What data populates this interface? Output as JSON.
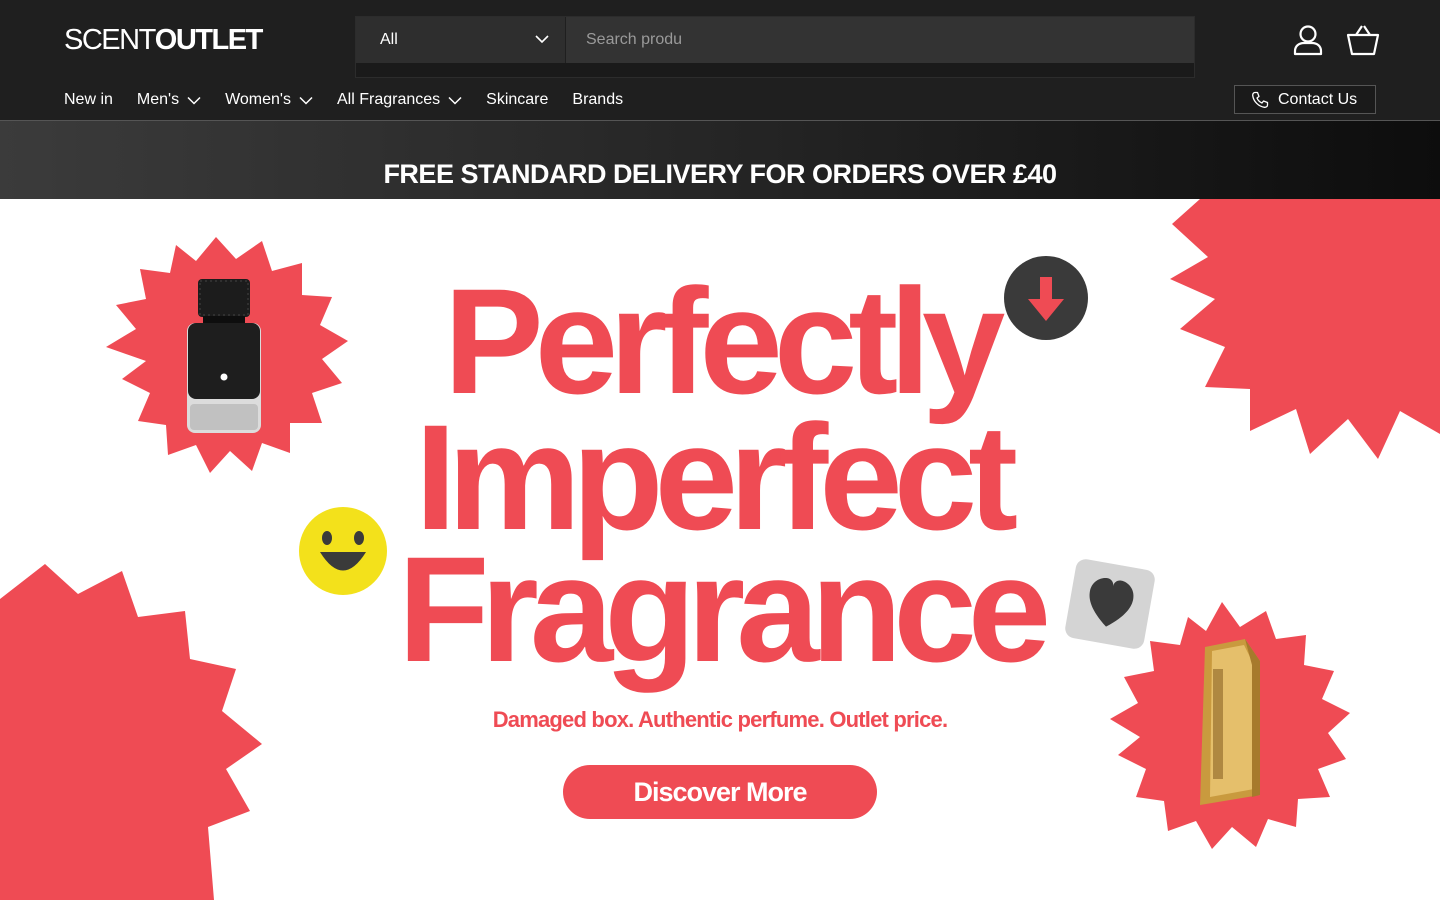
{
  "header": {
    "logo": {
      "part1": "SCENT",
      "part2": "OUTLET"
    },
    "search": {
      "category_selected": "All",
      "placeholder": "Search produ"
    },
    "nav": [
      {
        "label": "New in",
        "has_dropdown": false
      },
      {
        "label": "Men's",
        "has_dropdown": true
      },
      {
        "label": "Women's",
        "has_dropdown": true
      },
      {
        "label": "All Fragrances",
        "has_dropdown": true
      },
      {
        "label": "Skincare",
        "has_dropdown": false
      },
      {
        "label": "Brands",
        "has_dropdown": false
      }
    ],
    "contact_label": "Contact Us",
    "icons": [
      "account-icon",
      "basket-icon",
      "phone-icon",
      "chevron-down-icon"
    ]
  },
  "announcement": "FREE STANDARD DELIVERY FOR ORDERS OVER £40",
  "hero": {
    "headline": [
      "Perfectly",
      "Imperfect",
      "Fragrance"
    ],
    "tagline": "Damaged box. Authentic perfume. Outlet price.",
    "cta_label": "Discover More",
    "decorations": [
      "starburst-shapes",
      "perfume-bottle-black",
      "perfume-bottle-gold",
      "smiley-emoji-icon",
      "down-arrow-icon",
      "heart-icon"
    ]
  },
  "colors": {
    "header_bg": "#1f1f1f",
    "brand_red": "#ef4b54",
    "smiley_yellow": "#f3e11b",
    "dark_badge": "#3a3a3a"
  }
}
